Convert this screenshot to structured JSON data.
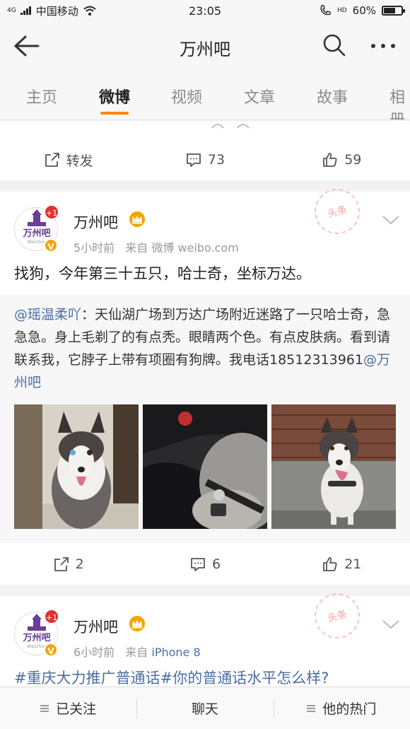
{
  "statusbar": {
    "carrier": "中国移动",
    "time": "23:05",
    "battery": "60%",
    "battery_level": 0.6,
    "network_small": "4G",
    "hd": "HD"
  },
  "navbar": {
    "title": "万州吧",
    "back_icon": "arrow-left-icon",
    "search_icon": "search-icon",
    "more_icon": "more-icon"
  },
  "tabs": [
    {
      "label": "主页",
      "active": false
    },
    {
      "label": "微博",
      "active": true
    },
    {
      "label": "视频",
      "active": false
    },
    {
      "label": "文章",
      "active": false
    },
    {
      "label": "故事",
      "active": false
    },
    {
      "label": "相册",
      "active": false
    }
  ],
  "prev_post": {
    "repost_label": "转发",
    "comments": "73",
    "likes": "59"
  },
  "post1": {
    "avatar_text": "万州吧",
    "avatar_sub": "Wanzhou",
    "plus_badge": "+1",
    "verified": "V",
    "user": "万州吧",
    "time": "5小时前",
    "from_label": "来自",
    "source": "微博 weibo.com",
    "stamp": "头条",
    "text": "找狗，今年第三十五只，哈士奇，坐标万达。",
    "retweet_user": "@瑶温柔吖",
    "retweet_body": "：天仙湖广场到万达广场附近迷路了一只哈士奇，急急急。身上毛剃了的有点秃。眼睛两个色。有点皮肤病。看到请联系我，它脖子上带有项圈有狗牌。我电话18512313961",
    "retweet_mention": "@万州吧",
    "reposts": "2",
    "comments": "6",
    "likes": "21"
  },
  "post2": {
    "avatar_text": "万州吧",
    "avatar_sub": "Wanzhou",
    "plus_badge": "+1",
    "verified": "V",
    "user": "万州吧",
    "time": "6小时前",
    "from_label": "来自",
    "source": "iPhone 8",
    "stamp": "头条",
    "text_peek": "#重庆大力推广普通话#你的普通话水平怎么样?"
  },
  "bottombar": [
    {
      "label": "已关注"
    },
    {
      "label": "聊天"
    },
    {
      "label": "他的热门"
    }
  ]
}
